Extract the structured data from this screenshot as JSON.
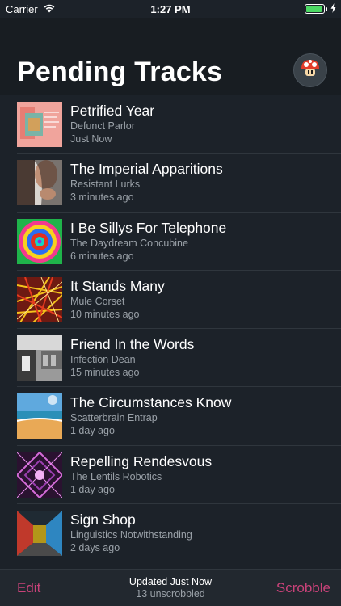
{
  "status_bar": {
    "carrier": "Carrier",
    "time": "1:27 PM",
    "battery_level": 0.9
  },
  "header": {
    "title": "Pending Tracks",
    "avatar_icon": "mushroom-icon"
  },
  "tracks": [
    {
      "title": "Petrified Year",
      "artist": "Defunct Parlor",
      "time": "Just Now"
    },
    {
      "title": "The Imperial Apparitions",
      "artist": "Resistant Lurks",
      "time": "3 minutes ago"
    },
    {
      "title": "I Be Sillys For Telephone",
      "artist": "The Daydream Concubine",
      "time": "6 minutes ago"
    },
    {
      "title": "It Stands Many",
      "artist": "Mule Corset",
      "time": "10 minutes ago"
    },
    {
      "title": "Friend In the Words",
      "artist": "Infection Dean",
      "time": "15 minutes ago"
    },
    {
      "title": "The Circumstances Know",
      "artist": "Scatterbrain Entrap",
      "time": "1 day ago"
    },
    {
      "title": "Repelling Rendesvous",
      "artist": "The Lentils Robotics",
      "time": "1 day ago"
    },
    {
      "title": "Sign Shop",
      "artist": "Linguistics Notwithstanding",
      "time": "2 days ago"
    }
  ],
  "toolbar": {
    "edit_label": "Edit",
    "status": "Updated Just Now",
    "count": "13 unscrobbled",
    "scrobble_label": "Scrobble"
  },
  "colors": {
    "accent": "#c94279",
    "background": "#1c2229",
    "battery": "#4cd964"
  }
}
